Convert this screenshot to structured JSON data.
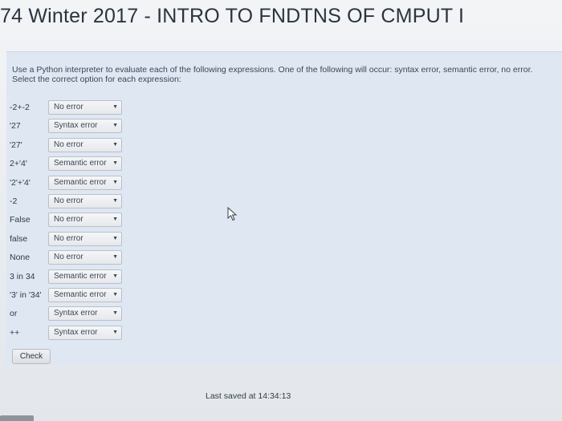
{
  "header": {
    "title": "74 Winter 2017 - INTRO TO FNDTNS OF CMPUT I"
  },
  "question": {
    "prompt": "Use a Python interpreter to evaluate each of the following expressions. One of the following will occur: syntax error, semantic error, no error. Select the correct option for each expression:",
    "items": [
      {
        "expr": "-2+-2",
        "answer": "No error"
      },
      {
        "expr": "'27",
        "answer": "Syntax error"
      },
      {
        "expr": "'27'",
        "answer": "No error"
      },
      {
        "expr": "2+'4'",
        "answer": "Semantic error"
      },
      {
        "expr": "'2'+'4'",
        "answer": "Semantic error"
      },
      {
        "expr": "-2",
        "answer": "No error"
      },
      {
        "expr": "False",
        "answer": "No error"
      },
      {
        "expr": "false",
        "answer": "No error"
      },
      {
        "expr": "None",
        "answer": "No error"
      },
      {
        "expr": "3 in 34",
        "answer": "Semantic error"
      },
      {
        "expr": "'3' in '34'",
        "answer": "Semantic error"
      },
      {
        "expr": "or",
        "answer": "Syntax error"
      },
      {
        "expr": "++",
        "answer": "Syntax error"
      }
    ],
    "caret_icon": "triangle-down"
  },
  "actions": {
    "check_label": "Check"
  },
  "status": {
    "last_saved": "Last saved at 14:34:13"
  }
}
